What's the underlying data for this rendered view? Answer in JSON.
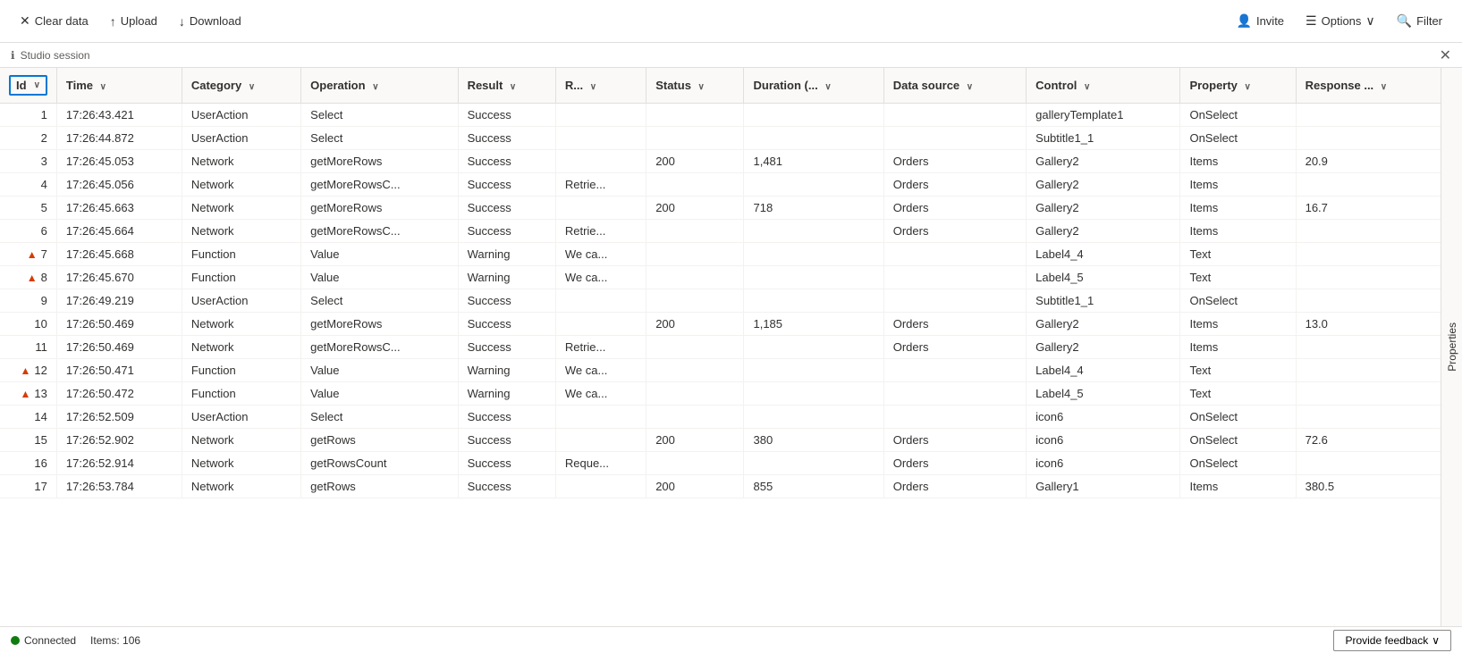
{
  "toolbar": {
    "clear_data_label": "Clear data",
    "upload_label": "Upload",
    "download_label": "Download",
    "invite_label": "Invite",
    "options_label": "Options",
    "filter_label": "Filter"
  },
  "session_bar": {
    "label": "Studio session"
  },
  "table": {
    "columns": [
      {
        "key": "id",
        "label": "Id",
        "sortable": true
      },
      {
        "key": "time",
        "label": "Time",
        "sortable": true
      },
      {
        "key": "category",
        "label": "Category",
        "sortable": true
      },
      {
        "key": "operation",
        "label": "Operation",
        "sortable": true
      },
      {
        "key": "result",
        "label": "Result",
        "sortable": true
      },
      {
        "key": "r",
        "label": "R...",
        "sortable": true
      },
      {
        "key": "status",
        "label": "Status",
        "sortable": true
      },
      {
        "key": "duration",
        "label": "Duration (..…",
        "sortable": true
      },
      {
        "key": "datasource",
        "label": "Data source",
        "sortable": true
      },
      {
        "key": "control",
        "label": "Control",
        "sortable": true
      },
      {
        "key": "property",
        "label": "Property",
        "sortable": true
      },
      {
        "key": "response",
        "label": "Response ...",
        "sortable": true
      }
    ],
    "rows": [
      {
        "id": 1,
        "warn": false,
        "time": "17:26:43.421",
        "category": "UserAction",
        "operation": "Select",
        "result": "Success",
        "r": "",
        "status": "",
        "duration": "",
        "datasource": "",
        "control": "galleryTemplate1",
        "property": "OnSelect",
        "response": ""
      },
      {
        "id": 2,
        "warn": false,
        "time": "17:26:44.872",
        "category": "UserAction",
        "operation": "Select",
        "result": "Success",
        "r": "",
        "status": "",
        "duration": "",
        "datasource": "",
        "control": "Subtitle1_1",
        "property": "OnSelect",
        "response": ""
      },
      {
        "id": 3,
        "warn": false,
        "time": "17:26:45.053",
        "category": "Network",
        "operation": "getMoreRows",
        "result": "Success",
        "r": "",
        "status": "200",
        "duration": "1,481",
        "datasource": "Orders",
        "control": "Gallery2",
        "property": "Items",
        "response": "20.9"
      },
      {
        "id": 4,
        "warn": false,
        "time": "17:26:45.056",
        "category": "Network",
        "operation": "getMoreRowsC...",
        "result": "Success",
        "r": "Retrie...",
        "status": "",
        "duration": "",
        "datasource": "Orders",
        "control": "Gallery2",
        "property": "Items",
        "response": ""
      },
      {
        "id": 5,
        "warn": false,
        "time": "17:26:45.663",
        "category": "Network",
        "operation": "getMoreRows",
        "result": "Success",
        "r": "",
        "status": "200",
        "duration": "718",
        "datasource": "Orders",
        "control": "Gallery2",
        "property": "Items",
        "response": "16.7"
      },
      {
        "id": 6,
        "warn": false,
        "time": "17:26:45.664",
        "category": "Network",
        "operation": "getMoreRowsC...",
        "result": "Success",
        "r": "Retrie...",
        "status": "",
        "duration": "",
        "datasource": "Orders",
        "control": "Gallery2",
        "property": "Items",
        "response": ""
      },
      {
        "id": 7,
        "warn": true,
        "time": "17:26:45.668",
        "category": "Function",
        "operation": "Value",
        "result": "Warning",
        "r": "We ca...",
        "status": "",
        "duration": "",
        "datasource": "",
        "control": "Label4_4",
        "property": "Text",
        "response": ""
      },
      {
        "id": 8,
        "warn": true,
        "time": "17:26:45.670",
        "category": "Function",
        "operation": "Value",
        "result": "Warning",
        "r": "We ca...",
        "status": "",
        "duration": "",
        "datasource": "",
        "control": "Label4_5",
        "property": "Text",
        "response": ""
      },
      {
        "id": 9,
        "warn": false,
        "time": "17:26:49.219",
        "category": "UserAction",
        "operation": "Select",
        "result": "Success",
        "r": "",
        "status": "",
        "duration": "",
        "datasource": "",
        "control": "Subtitle1_1",
        "property": "OnSelect",
        "response": ""
      },
      {
        "id": 10,
        "warn": false,
        "time": "17:26:50.469",
        "category": "Network",
        "operation": "getMoreRows",
        "result": "Success",
        "r": "",
        "status": "200",
        "duration": "1,185",
        "datasource": "Orders",
        "control": "Gallery2",
        "property": "Items",
        "response": "13.0"
      },
      {
        "id": 11,
        "warn": false,
        "time": "17:26:50.469",
        "category": "Network",
        "operation": "getMoreRowsC...",
        "result": "Success",
        "r": "Retrie...",
        "status": "",
        "duration": "",
        "datasource": "Orders",
        "control": "Gallery2",
        "property": "Items",
        "response": ""
      },
      {
        "id": 12,
        "warn": true,
        "time": "17:26:50.471",
        "category": "Function",
        "operation": "Value",
        "result": "Warning",
        "r": "We ca...",
        "status": "",
        "duration": "",
        "datasource": "",
        "control": "Label4_4",
        "property": "Text",
        "response": ""
      },
      {
        "id": 13,
        "warn": true,
        "time": "17:26:50.472",
        "category": "Function",
        "operation": "Value",
        "result": "Warning",
        "r": "We ca...",
        "status": "",
        "duration": "",
        "datasource": "",
        "control": "Label4_5",
        "property": "Text",
        "response": ""
      },
      {
        "id": 14,
        "warn": false,
        "time": "17:26:52.509",
        "category": "UserAction",
        "operation": "Select",
        "result": "Success",
        "r": "",
        "status": "",
        "duration": "",
        "datasource": "",
        "control": "icon6",
        "property": "OnSelect",
        "response": ""
      },
      {
        "id": 15,
        "warn": false,
        "time": "17:26:52.902",
        "category": "Network",
        "operation": "getRows",
        "result": "Success",
        "r": "",
        "status": "200",
        "duration": "380",
        "datasource": "Orders",
        "control": "icon6",
        "property": "OnSelect",
        "response": "72.6"
      },
      {
        "id": 16,
        "warn": false,
        "time": "17:26:52.914",
        "category": "Network",
        "operation": "getRowsCount",
        "result": "Success",
        "r": "Reque...",
        "status": "",
        "duration": "",
        "datasource": "Orders",
        "control": "icon6",
        "property": "OnSelect",
        "response": ""
      },
      {
        "id": 17,
        "warn": false,
        "time": "17:26:53.784",
        "category": "Network",
        "operation": "getRows",
        "result": "Success",
        "r": "",
        "status": "200",
        "duration": "855",
        "datasource": "Orders",
        "control": "Gallery1",
        "property": "Items",
        "response": "380.5"
      }
    ]
  },
  "right_panel": {
    "label": "Properties"
  },
  "status_bar": {
    "connected_label": "Connected",
    "items_label": "Items: 106",
    "provide_feedback_label": "Provide feedback"
  },
  "icons": {
    "clear": "✕",
    "upload": "↑",
    "download": "↓",
    "invite": "👤",
    "options": "☰",
    "filter": "🔍",
    "sort_down": "∨",
    "warn": "▲",
    "close": "✕",
    "chevron_right": "›",
    "chevron_down": "⌄",
    "info": "ℹ"
  }
}
